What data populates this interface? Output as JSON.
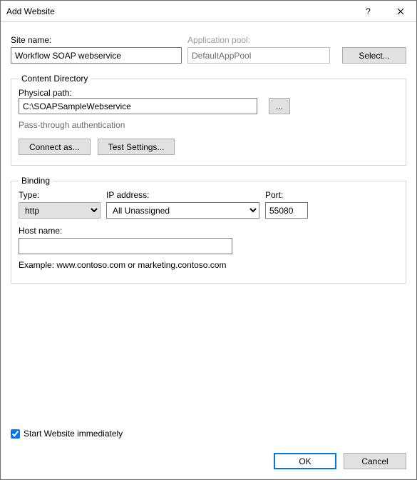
{
  "window": {
    "title": "Add Website"
  },
  "siteName": {
    "label": "Site name:",
    "value": "Workflow SOAP webservice"
  },
  "appPool": {
    "label": "Application pool:",
    "value": "DefaultAppPool",
    "selectBtn": "Select..."
  },
  "contentDir": {
    "legend": "Content Directory",
    "physicalPathLabel": "Physical path:",
    "physicalPath": "C:\\SOAPSampleWebservice",
    "browse": "...",
    "passthrough": "Pass-through authentication",
    "connectAs": "Connect as...",
    "testSettings": "Test Settings..."
  },
  "binding": {
    "legend": "Binding",
    "typeLabel": "Type:",
    "type": "http",
    "ipLabel": "IP address:",
    "ip": "All Unassigned",
    "portLabel": "Port:",
    "port": "55080",
    "hostLabel": "Host name:",
    "host": "",
    "example": "Example: www.contoso.com or marketing.contoso.com"
  },
  "startImmediately": {
    "label": "Start Website immediately",
    "checked": true
  },
  "footer": {
    "ok": "OK",
    "cancel": "Cancel"
  }
}
